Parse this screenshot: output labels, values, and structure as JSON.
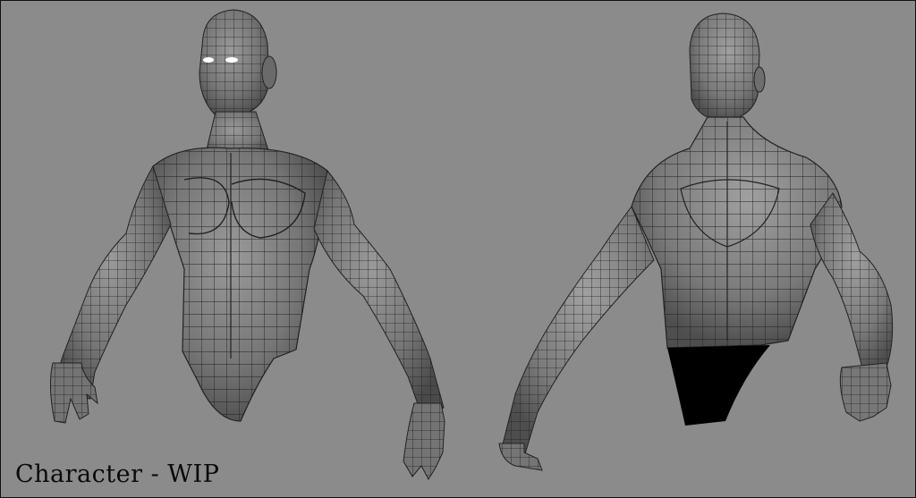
{
  "caption": "Character - WIP",
  "colors": {
    "background": "#8b8b8b",
    "mesh_fill": "#6f6f6f",
    "wireframe": "#1e1e1e",
    "interior": "#000000",
    "eye_glow": "#ffffff"
  },
  "views": [
    {
      "name": "front-view"
    },
    {
      "name": "back-view"
    }
  ]
}
